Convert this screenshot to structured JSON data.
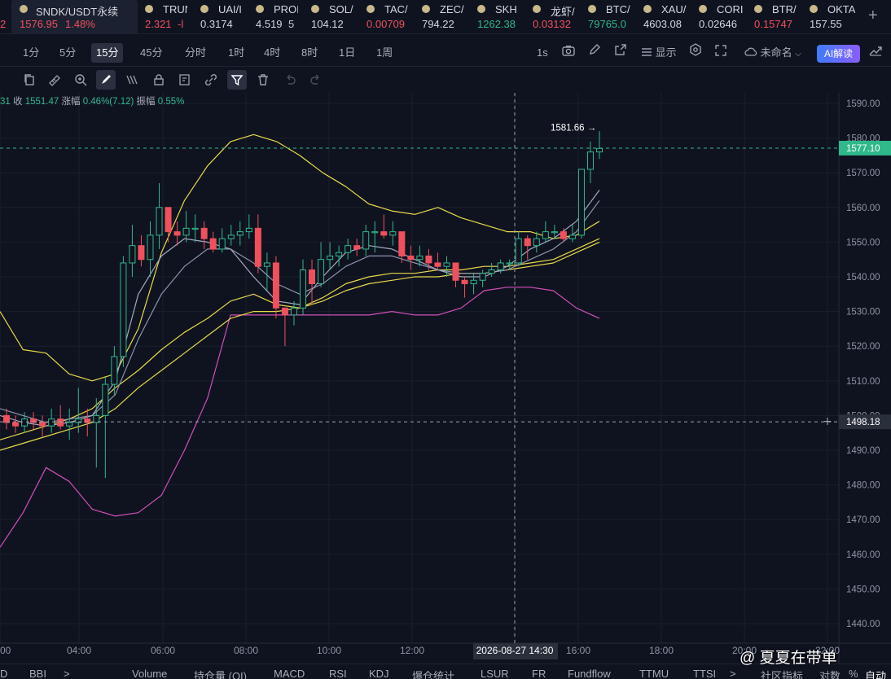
{
  "ticker": [
    {
      "name": "SNDK/USDT永续",
      "price": "1576.95",
      "change": "1.48%",
      "dir": "red",
      "x": 18,
      "w": 150,
      "active": true
    },
    {
      "name": "TRUN",
      "price": "2.321",
      "change": "-l",
      "dir": "red",
      "x": 178,
      "w": 52
    },
    {
      "name": "UAI/I",
      "price": "0.3174",
      "change": "",
      "dir": "none",
      "x": 246,
      "w": 52
    },
    {
      "name": "PROI",
      "price": "4.519",
      "change": "5",
      "dir": "none",
      "x": 314,
      "w": 52
    },
    {
      "name": "SOL/",
      "price": "104.12",
      "change": "",
      "dir": "none",
      "x": 382,
      "w": 52
    },
    {
      "name": "TAC/",
      "price": "0.00709",
      "change": "",
      "dir": "red",
      "x": 450,
      "w": 52
    },
    {
      "name": "ZEC/",
      "price": "794.22",
      "change": "",
      "dir": "none",
      "x": 518,
      "w": 52
    },
    {
      "name": "SKH",
      "price": "1262.38",
      "change": "",
      "dir": "green",
      "x": 586,
      "w": 52
    },
    {
      "name": "龙虾/",
      "price": "0.03132",
      "change": "",
      "dir": "red",
      "x": 654,
      "w": 52
    },
    {
      "name": "BTC/",
      "price": "79765.0",
      "change": "",
      "dir": "green",
      "x": 722,
      "w": 56
    },
    {
      "name": "XAU/",
      "price": "4603.08",
      "change": "",
      "dir": "none",
      "x": 790,
      "w": 56
    },
    {
      "name": "CORI",
      "price": "0.02646",
      "change": "",
      "dir": "none",
      "x": 858,
      "w": 56
    },
    {
      "name": "BTR/",
      "price": "0.15747",
      "change": "",
      "dir": "red",
      "x": 926,
      "w": 56
    },
    {
      "name": "OKTA",
      "price": "157.55",
      "change": "",
      "dir": "none",
      "x": 994,
      "w": 56
    }
  ],
  "ticker_left_fragment": "2",
  "ticker_add_label": "+",
  "intervals": [
    "1分",
    "5分",
    "15分",
    "45分",
    "分时",
    "1时",
    "4时",
    "8时",
    "1日",
    "1周"
  ],
  "interval_selected": "15分",
  "toolbar": {
    "seconds_label": "1s",
    "display_label": "显示",
    "unnamed_label": "未命名",
    "ai_label": "AI解读"
  },
  "stats": {
    "prefix": "31",
    "close_label": "收",
    "close": "1551.47",
    "change_label": "涨幅",
    "change": "0.46%(7.12)",
    "amp_label": "振幅",
    "amp": "0.55%"
  },
  "colors": {
    "up": "#2fb88a",
    "down": "#f0505c",
    "boll_upper": "#e8d94a",
    "boll_lower": "#d14fb8",
    "ma": "#8b93ad",
    "ma_yellow": "#e8d94a",
    "accent": "#2fb88a"
  },
  "chart_data": {
    "type": "candlestick",
    "price_axis": [
      "1590.00",
      "1580.00",
      "1570.00",
      "1560.00",
      "1550.00",
      "1540.00",
      "1530.00",
      "1520.00",
      "1510.00",
      "1500.00",
      "1490.00",
      "1480.00",
      "1470.00",
      "1460.00",
      "1450.00",
      "1440.00"
    ],
    "time_axis": [
      "00",
      "04:00",
      "06:00",
      "08:00",
      "10:00",
      "12:00",
      "2026-08-27 14:30",
      "16:00",
      "18:00",
      "20:00",
      "22:00"
    ],
    "current_price": "1577.10",
    "crosshair_price": "1498.18",
    "high_label": "1581.66 →",
    "ylim": [
      1436,
      1596
    ],
    "candles": [
      [
        1500,
        1498,
        1502,
        1496
      ],
      [
        1498,
        1497,
        1500,
        1495
      ],
      [
        1497,
        1499,
        1501,
        1495
      ],
      [
        1499,
        1498,
        1501,
        1496
      ],
      [
        1498,
        1497,
        1500,
        1494
      ],
      [
        1497,
        1499,
        1502,
        1495
      ],
      [
        1499,
        1497,
        1503,
        1496
      ],
      [
        1497,
        1498,
        1502,
        1493
      ],
      [
        1498,
        1499,
        1508,
        1495
      ],
      [
        1499,
        1498,
        1502,
        1494
      ],
      [
        1498,
        1500,
        1505,
        1485
      ],
      [
        1500,
        1509,
        1511,
        1482
      ],
      [
        1509,
        1517,
        1520,
        1506
      ],
      [
        1517,
        1544,
        1546,
        1514
      ],
      [
        1544,
        1549,
        1555,
        1540
      ],
      [
        1549,
        1545,
        1552,
        1543
      ],
      [
        1545,
        1552,
        1556,
        1540
      ],
      [
        1552,
        1560,
        1567,
        1548
      ],
      [
        1560,
        1553,
        1558,
        1550
      ],
      [
        1553,
        1552,
        1556,
        1549
      ],
      [
        1552,
        1554,
        1559,
        1550
      ],
      [
        1554,
        1554,
        1558,
        1550
      ],
      [
        1554,
        1551,
        1556,
        1548
      ],
      [
        1551,
        1548,
        1553,
        1547
      ],
      [
        1548,
        1551,
        1554,
        1547
      ],
      [
        1551,
        1552,
        1555,
        1549
      ],
      [
        1552,
        1553,
        1556,
        1549
      ],
      [
        1553,
        1554,
        1558,
        1551
      ],
      [
        1554,
        1543,
        1558,
        1541
      ],
      [
        1543,
        1544,
        1547,
        1536
      ],
      [
        1544,
        1531,
        1546,
        1528
      ],
      [
        1531,
        1529,
        1531,
        1520
      ],
      [
        1529,
        1531,
        1533,
        1526
      ],
      [
        1531,
        1542,
        1545,
        1529
      ],
      [
        1542,
        1538,
        1545,
        1532
      ],
      [
        1538,
        1545,
        1550,
        1537
      ],
      [
        1545,
        1546,
        1550,
        1542
      ],
      [
        1546,
        1547,
        1549,
        1543
      ],
      [
        1547,
        1549,
        1551,
        1545
      ],
      [
        1549,
        1548,
        1551,
        1546
      ],
      [
        1548,
        1553,
        1555,
        1546
      ],
      [
        1553,
        1553,
        1556,
        1547
      ],
      [
        1553,
        1552,
        1558,
        1551
      ],
      [
        1552,
        1553,
        1556,
        1549
      ],
      [
        1553,
        1546,
        1553,
        1544
      ],
      [
        1546,
        1545,
        1549,
        1542
      ],
      [
        1545,
        1546,
        1549,
        1543
      ],
      [
        1546,
        1544,
        1548,
        1542
      ],
      [
        1544,
        1543,
        1547,
        1542
      ],
      [
        1543,
        1544,
        1546,
        1540
      ],
      [
        1544,
        1539,
        1544,
        1537
      ],
      [
        1539,
        1538,
        1540,
        1534
      ],
      [
        1538,
        1539,
        1541,
        1535
      ],
      [
        1539,
        1541,
        1542,
        1537
      ],
      [
        1541,
        1542,
        1544,
        1540
      ],
      [
        1542,
        1544,
        1545,
        1541
      ],
      [
        1544,
        1544,
        1545,
        1542
      ],
      [
        1544,
        1551,
        1553,
        1543
      ],
      [
        1551,
        1549,
        1552,
        1545
      ],
      [
        1549,
        1551,
        1553,
        1547
      ],
      [
        1551,
        1553,
        1556,
        1550
      ],
      [
        1553,
        1553,
        1555,
        1551
      ],
      [
        1553,
        1551,
        1554,
        1550
      ],
      [
        1551,
        1552,
        1555,
        1550
      ],
      [
        1552,
        1571,
        1571,
        1551
      ],
      [
        1571,
        1576,
        1579,
        1567
      ],
      [
        1576,
        1577,
        1582,
        1574
      ]
    ],
    "boll_upper": [
      1530,
      1519,
      1518,
      1512,
      1510,
      1512,
      1525,
      1547,
      1562,
      1572,
      1579,
      1581,
      1579,
      1575,
      1570,
      1566,
      1561,
      1559,
      1558,
      1560,
      1557,
      1555,
      1553,
      1553,
      1551,
      1552,
      1556
    ],
    "boll_lower": [
      1462,
      1472,
      1485,
      1481,
      1473,
      1471,
      1472,
      1477,
      1490,
      1505,
      1529,
      1529,
      1529,
      1529,
      1529,
      1529,
      1529,
      1530,
      1529,
      1529,
      1531,
      1536,
      1537,
      1537,
      1536,
      1531,
      1528
    ],
    "ma_gray1": [
      1500,
      1498,
      1497,
      1498,
      1500,
      1510,
      1535,
      1546,
      1551,
      1550,
      1548,
      1540,
      1533,
      1532,
      1540,
      1547,
      1549,
      1548,
      1545,
      1542,
      1540,
      1540,
      1543,
      1548,
      1551,
      1556,
      1565
    ],
    "ma_gray2": [
      1502,
      1500,
      1498,
      1499,
      1500,
      1506,
      1522,
      1535,
      1543,
      1548,
      1548,
      1544,
      1538,
      1535,
      1538,
      1543,
      1546,
      1546,
      1544,
      1542,
      1541,
      1541,
      1542,
      1545,
      1548,
      1553,
      1562
    ],
    "ma_yellow1": [
      1493,
      1495,
      1497,
      1499,
      1502,
      1508,
      1513,
      1519,
      1524,
      1528,
      1533,
      1535,
      1532,
      1531,
      1534,
      1538,
      1540,
      1541,
      1541,
      1542,
      1542,
      1543,
      1543,
      1544,
      1545,
      1548,
      1551
    ],
    "ma_yellow2": [
      1490,
      1492,
      1494,
      1496,
      1498,
      1502,
      1508,
      1513,
      1518,
      1523,
      1528,
      1530,
      1530,
      1531,
      1533,
      1536,
      1538,
      1539,
      1540,
      1540,
      1541,
      1541,
      1542,
      1543,
      1544,
      1547,
      1550
    ]
  },
  "bottom": {
    "items": [
      "BBI",
      ">",
      "Volume",
      "持仓量 (OI)",
      "MACD",
      "RSI",
      "KDJ",
      "爆仓统计",
      "LSUR",
      "FR",
      "Fundflow",
      "TTMU",
      "TTSI",
      ">",
      "社区指标",
      "对数",
      "%",
      "自动"
    ],
    "left_fragment": "D"
  },
  "watermark": "@ 夏夏在带单"
}
